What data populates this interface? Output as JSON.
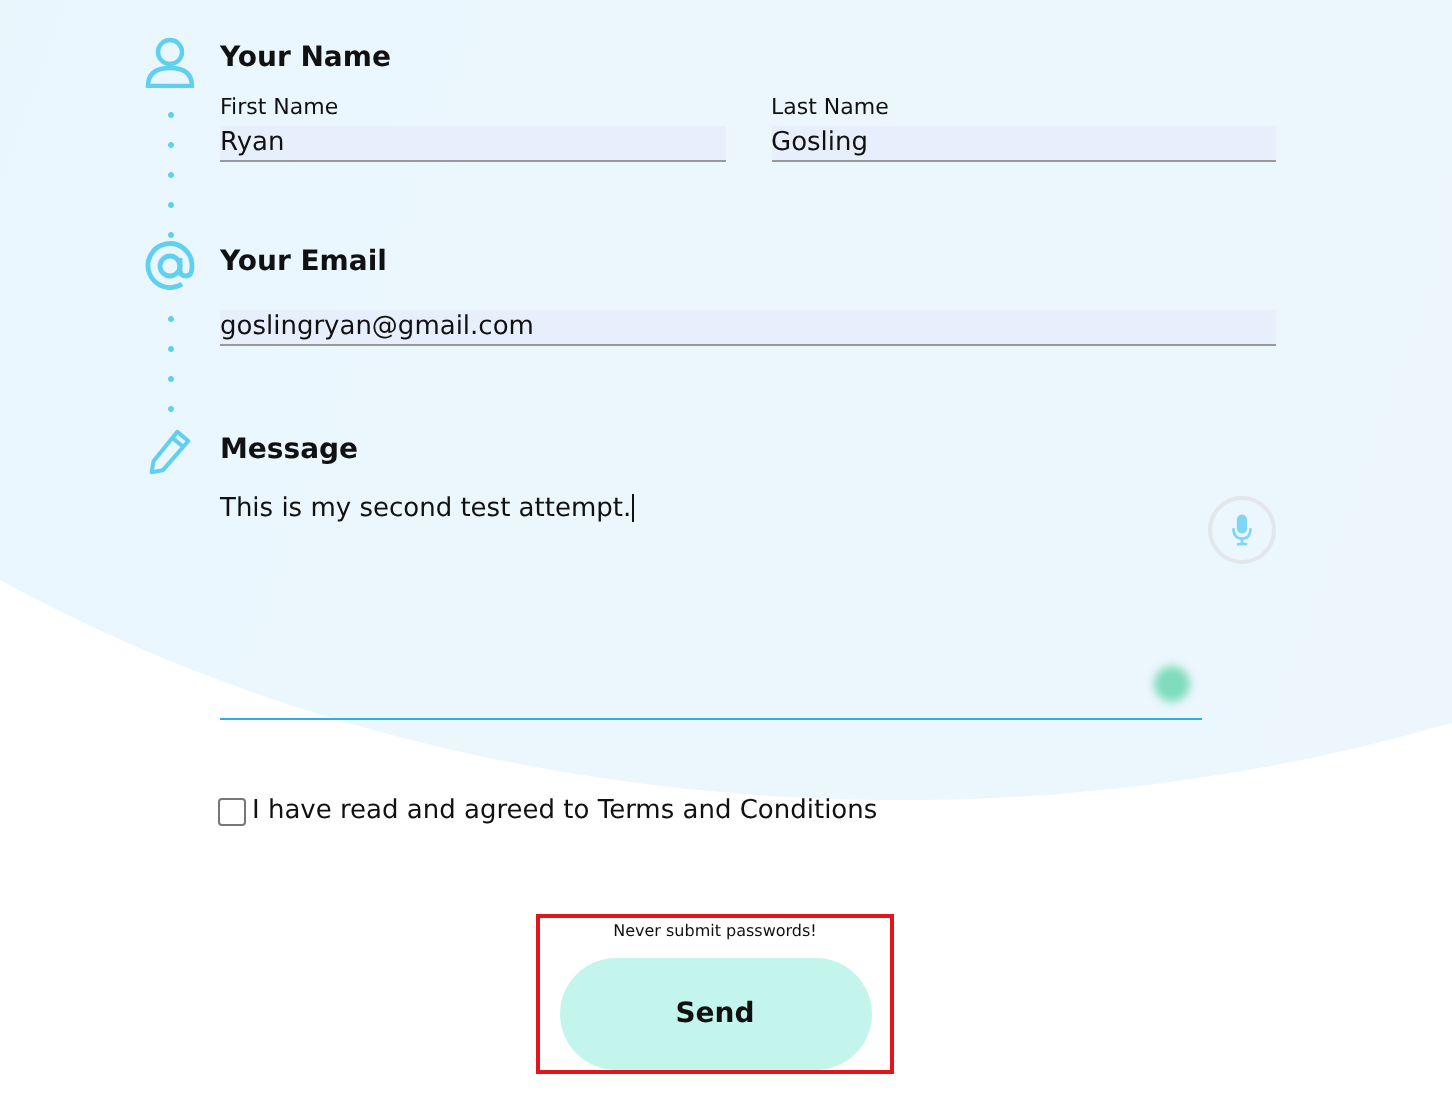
{
  "name_section": {
    "heading": "Your Name",
    "first_name": {
      "label": "First Name",
      "value": "Ryan"
    },
    "last_name": {
      "label": "Last Name",
      "value": "Gosling"
    }
  },
  "email_section": {
    "heading": "Your Email",
    "value": "goslingryan@gmail.com"
  },
  "message_section": {
    "heading": "Message",
    "value": "This is my second test attempt."
  },
  "terms": {
    "label": "I have read and agreed to Terms and Conditions",
    "checked": false
  },
  "hint": "Never submit passwords!",
  "send_button": {
    "label": "Send",
    "highlighted": true
  }
}
